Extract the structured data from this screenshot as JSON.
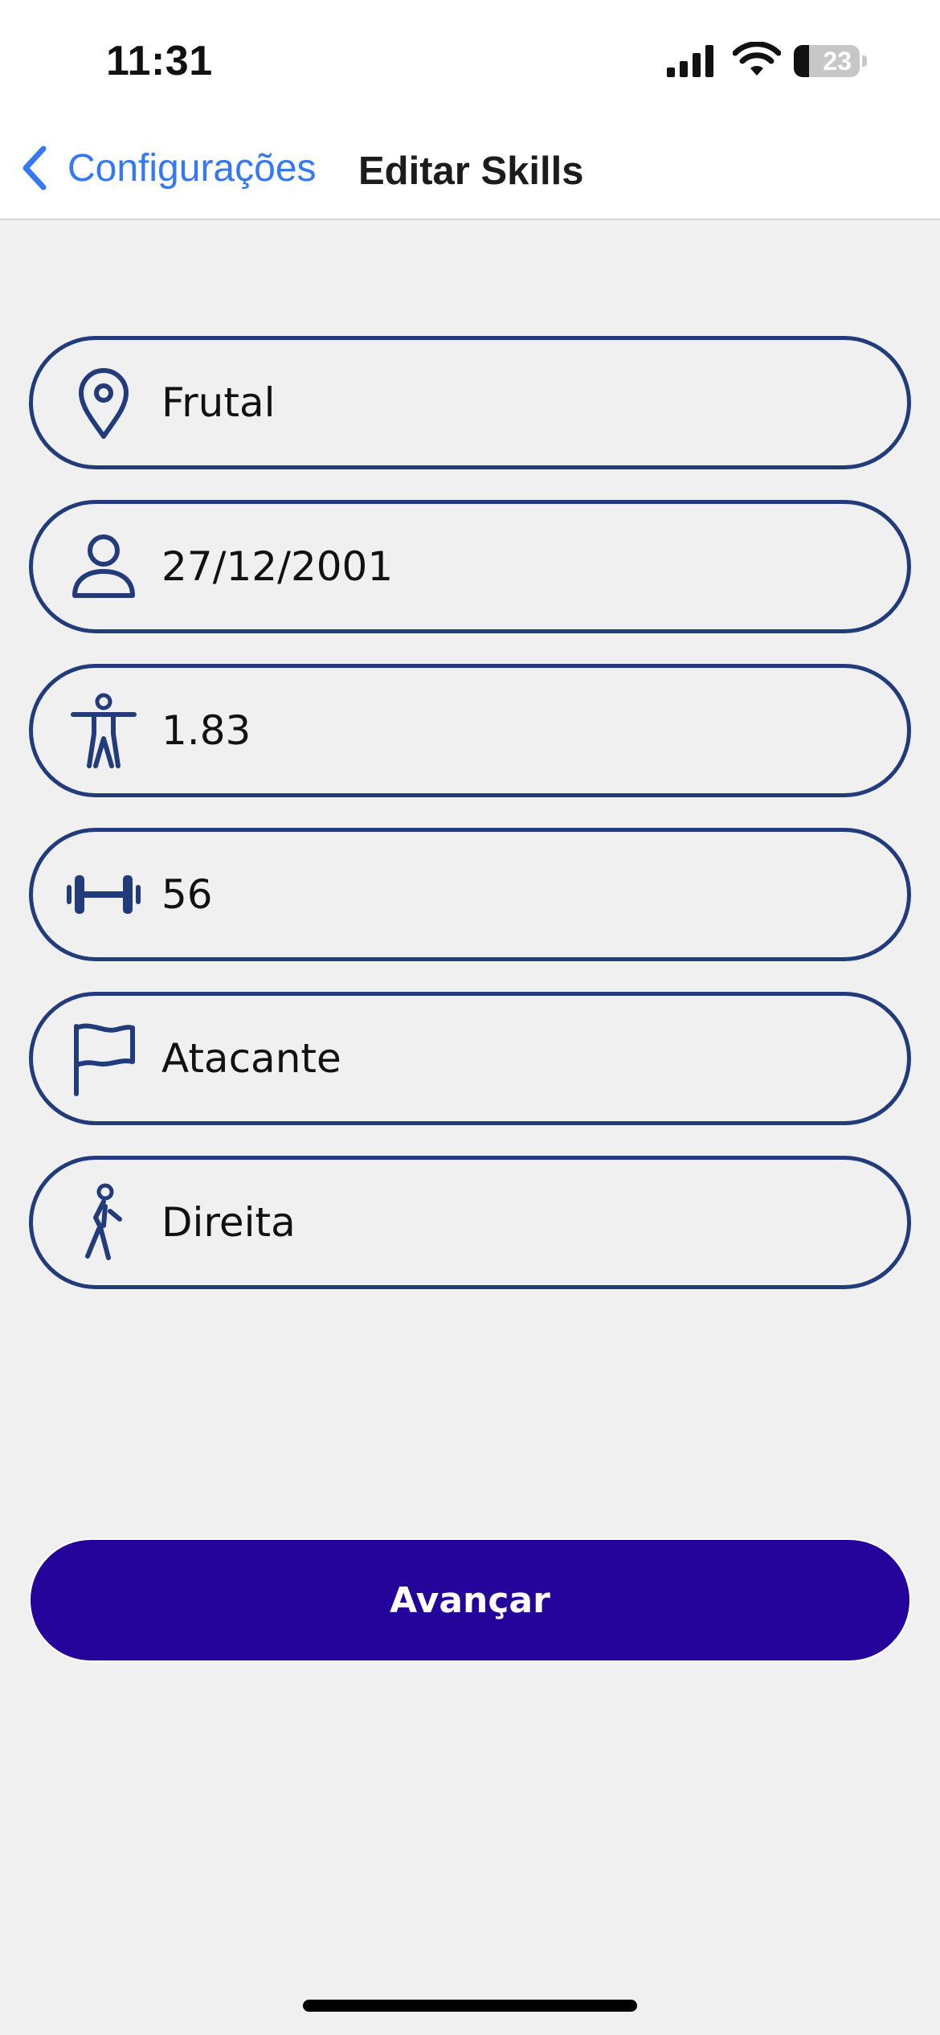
{
  "status_bar": {
    "time": "11:31",
    "battery_level": "23",
    "battery_fraction": 0.23
  },
  "nav": {
    "back_label": "Configurações",
    "title": "Editar Skills"
  },
  "fields": [
    {
      "name": "location",
      "icon": "location-pin-icon",
      "value": "Frutal"
    },
    {
      "name": "birthdate",
      "icon": "person-icon",
      "value": "27/12/2001"
    },
    {
      "name": "height",
      "icon": "body-figure-icon",
      "value": "1.83"
    },
    {
      "name": "weight",
      "icon": "dumbbell-icon",
      "value": "56"
    },
    {
      "name": "position",
      "icon": "flag-icon",
      "value": "Atacante"
    },
    {
      "name": "dominant-foot",
      "icon": "walking-person-icon",
      "value": "Direita"
    }
  ],
  "actions": {
    "advance_label": "Avançar"
  },
  "colors": {
    "field_border": "#223b7a",
    "primary_button": "#24049a",
    "link_blue": "#3478f6",
    "background": "#f0f0f1"
  }
}
